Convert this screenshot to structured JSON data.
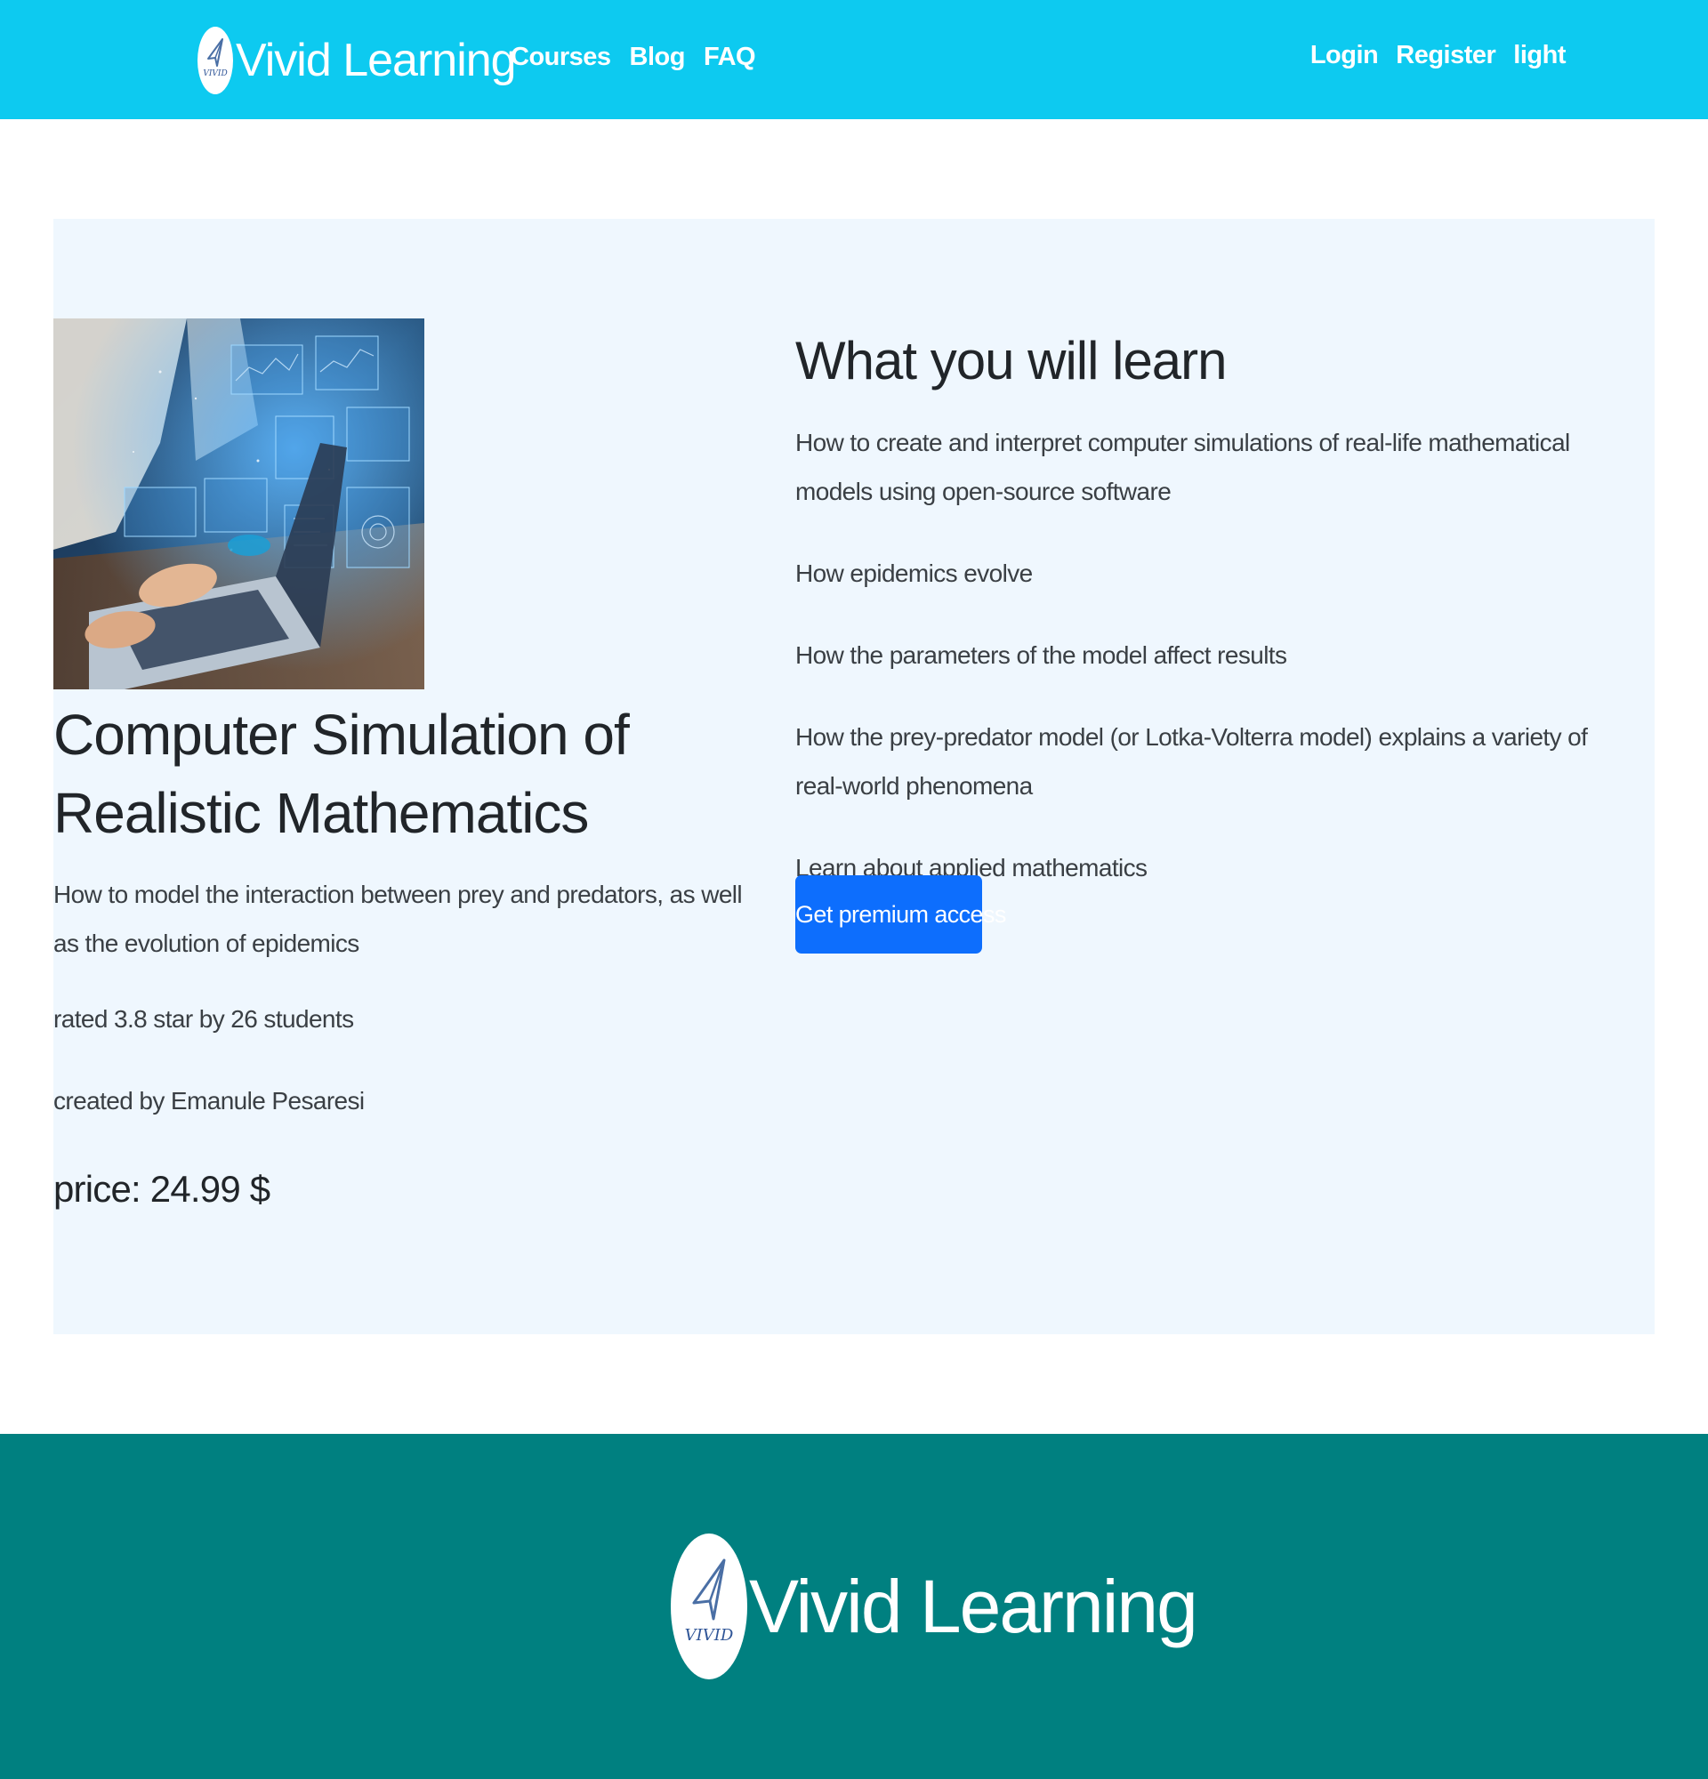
{
  "header": {
    "brand": "Vivid Learning",
    "logo_text": "VIVID",
    "nav": [
      "Courses",
      "Blog",
      "FAQ"
    ],
    "auth": [
      "Login",
      "Register",
      "light"
    ]
  },
  "course": {
    "image_alt": "person typing on laptop with holographic data",
    "title": "Computer Simulation of Realistic Mathematics",
    "description": "How to model the interaction between prey and predators, as well as the evolution of epidemics",
    "rating": "rated 3.8 star by 26 students",
    "author": "created by Emanule Pesaresi",
    "price": "price: 24.99 $"
  },
  "learn": {
    "heading": "What you will learn",
    "items": [
      "How to create and interpret computer simulations of real-life mathematical models using open-source software",
      "How epidemics evolve",
      "How the parameters of the model affect results",
      "How the prey-predator model (or Lotka-Volterra model) explains a variety of real-world phenomena",
      "Learn about applied mathematics"
    ],
    "button_label": "Get premium access"
  },
  "footer": {
    "brand": "Vivid Learning",
    "logo_text": "VIVID"
  },
  "colors": {
    "header_bg": "#0dcaf0",
    "card_bg": "#eff7fe",
    "button_bg": "#0d6efd",
    "footer_bg": "#008080"
  }
}
